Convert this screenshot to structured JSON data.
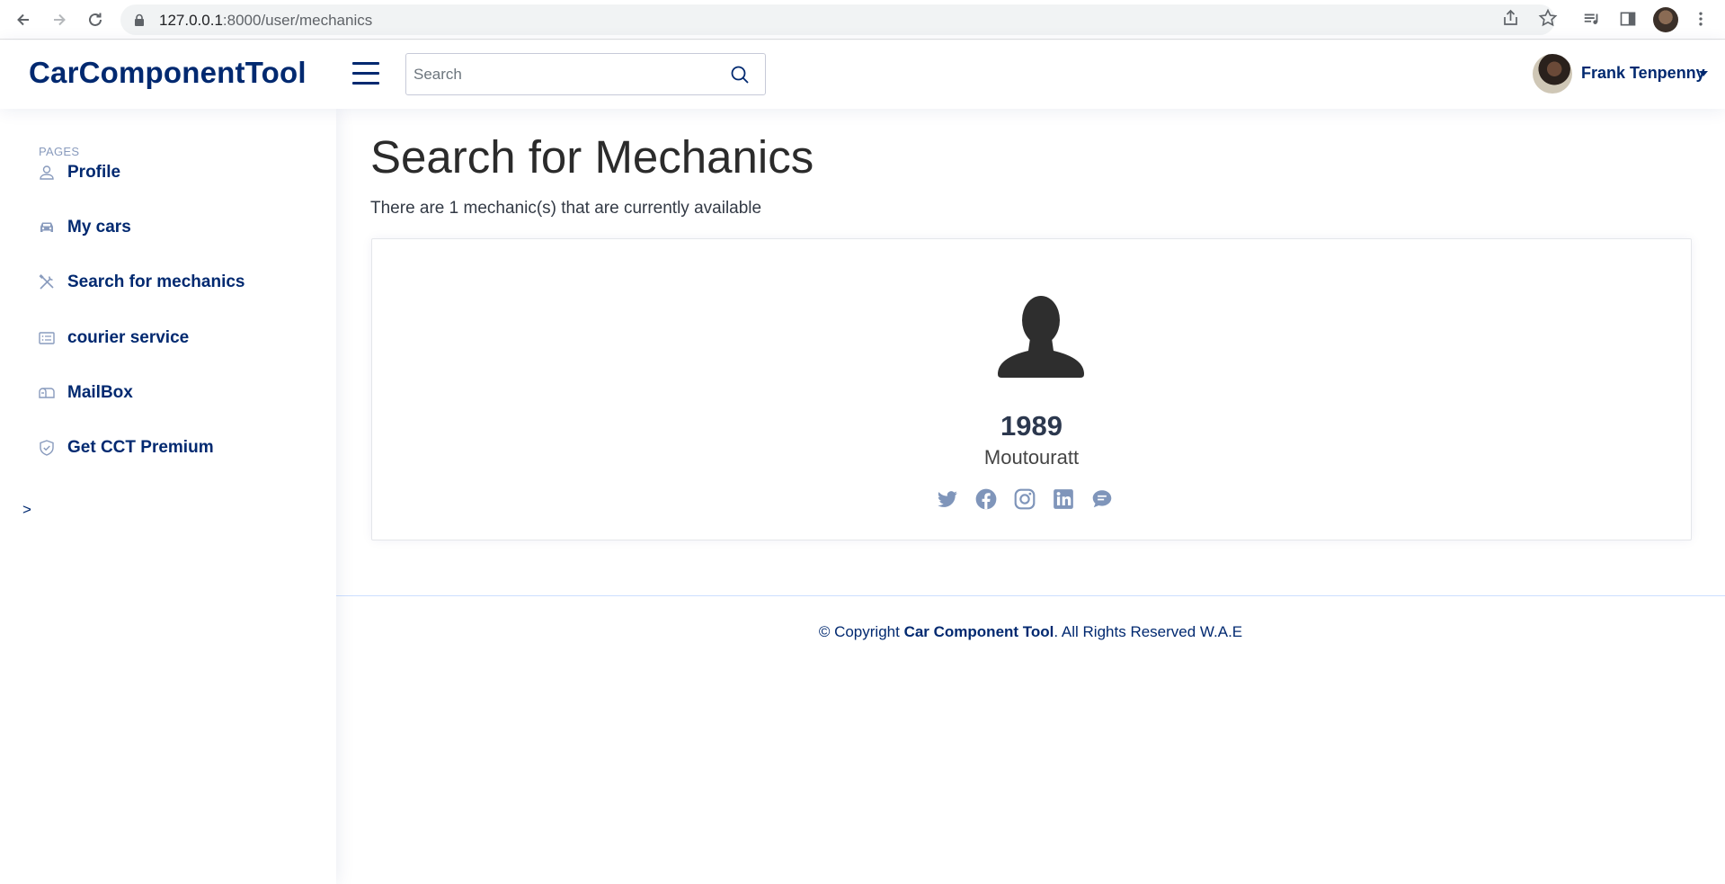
{
  "browser": {
    "url_host": "127.0.0.1",
    "url_rest": ":8000/user/mechanics"
  },
  "header": {
    "logo": "CarComponentTool",
    "search_placeholder": "Search",
    "user_name": "Frank Tenpenny"
  },
  "sidebar": {
    "heading": "PAGES",
    "items": [
      {
        "label": "Profile",
        "icon": "person-icon"
      },
      {
        "label": "My cars",
        "icon": "car-icon"
      },
      {
        "label": "Search for mechanics",
        "icon": "tools-icon"
      },
      {
        "label": "courier service",
        "icon": "card-list-icon"
      },
      {
        "label": "MailBox",
        "icon": "mailbox-icon"
      },
      {
        "label": "Get CCT Premium",
        "icon": "shield-check-icon"
      }
    ],
    "toggle": ">"
  },
  "main": {
    "title": "Search for Mechanics",
    "subtitle": "There are 1 mechanic(s) that are currently available",
    "mechanic": {
      "name": "1989",
      "city": "Moutouratt",
      "socials": [
        "twitter-icon",
        "facebook-icon",
        "instagram-icon",
        "linkedin-icon",
        "chat-icon"
      ]
    }
  },
  "footer": {
    "prefix": "© Copyright ",
    "brand": "Car Component Tool",
    "suffix": ". All Rights Reserved W.A.E"
  },
  "colors": {
    "primary": "#012970",
    "muted": "#899bbd",
    "social": "#7f95ba"
  }
}
